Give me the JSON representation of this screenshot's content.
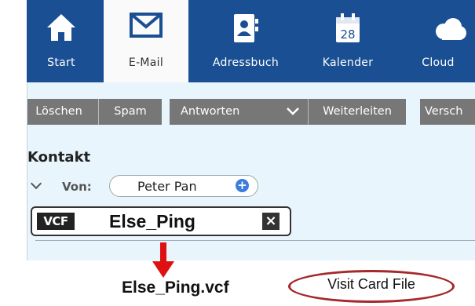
{
  "nav": {
    "items": [
      {
        "label": "Start",
        "icon": "home-icon"
      },
      {
        "label": "E-Mail",
        "icon": "envelope-icon"
      },
      {
        "label": "Adressbuch",
        "icon": "address-book-icon"
      },
      {
        "label": "Kalender",
        "icon": "calendar-icon",
        "badge": "28"
      },
      {
        "label": "Cloud",
        "icon": "cloud-icon"
      }
    ],
    "active": "E-Mail",
    "color": "#1a4f94"
  },
  "toolbar": {
    "delete_label": "Löschen",
    "spam_label": "Spam",
    "reply_label": "Antworten",
    "forward_label": "Weiterleiten",
    "move_label": "Versch"
  },
  "message": {
    "title": "Kontakt",
    "from_label": "Von:",
    "sender": "Peter Pan"
  },
  "attachment": {
    "type_badge": "VCF",
    "name": "Else_Ping"
  },
  "annotation": {
    "file_name": "Else_Ping.vcf",
    "callout": "Visit Card File",
    "arrow_color": "#dd1111",
    "ellipse_color": "#a5282a"
  }
}
